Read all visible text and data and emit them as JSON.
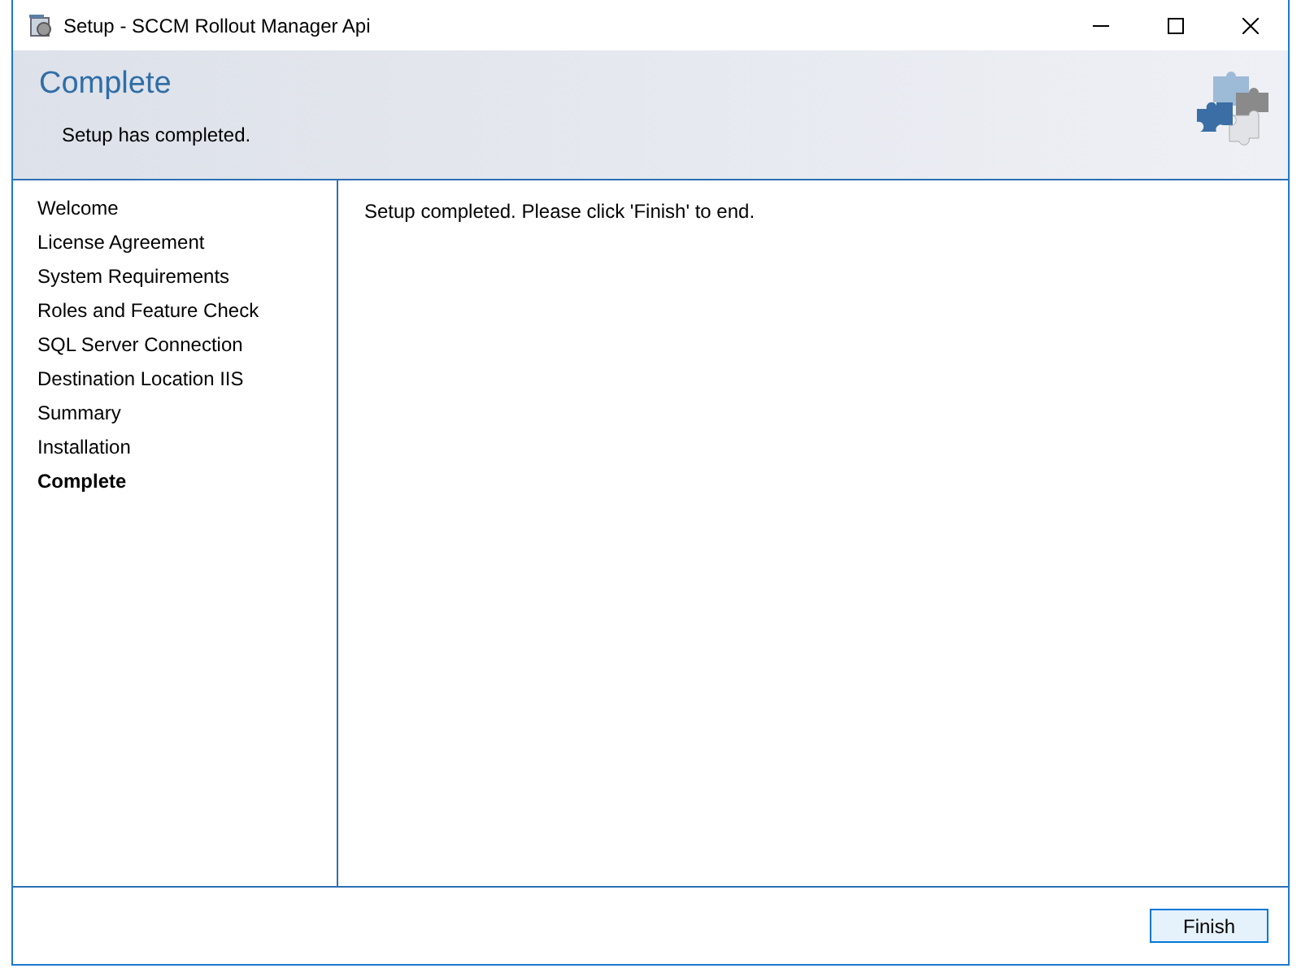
{
  "window": {
    "title": "Setup - SCCM Rollout Manager Api"
  },
  "header": {
    "title": "Complete",
    "subtitle": "Setup has completed."
  },
  "steps": [
    {
      "label": "Welcome",
      "selected": false
    },
    {
      "label": "License Agreement",
      "selected": false
    },
    {
      "label": "System Requirements",
      "selected": false
    },
    {
      "label": "Roles and Feature Check",
      "selected": false
    },
    {
      "label": "SQL Server Connection",
      "selected": false
    },
    {
      "label": "Destination Location IIS",
      "selected": false
    },
    {
      "label": "Summary",
      "selected": false
    },
    {
      "label": "Installation",
      "selected": false
    },
    {
      "label": "Complete",
      "selected": true
    }
  ],
  "message": "Setup completed. Please click 'Finish' to end.",
  "buttons": [
    "Finish"
  ]
}
